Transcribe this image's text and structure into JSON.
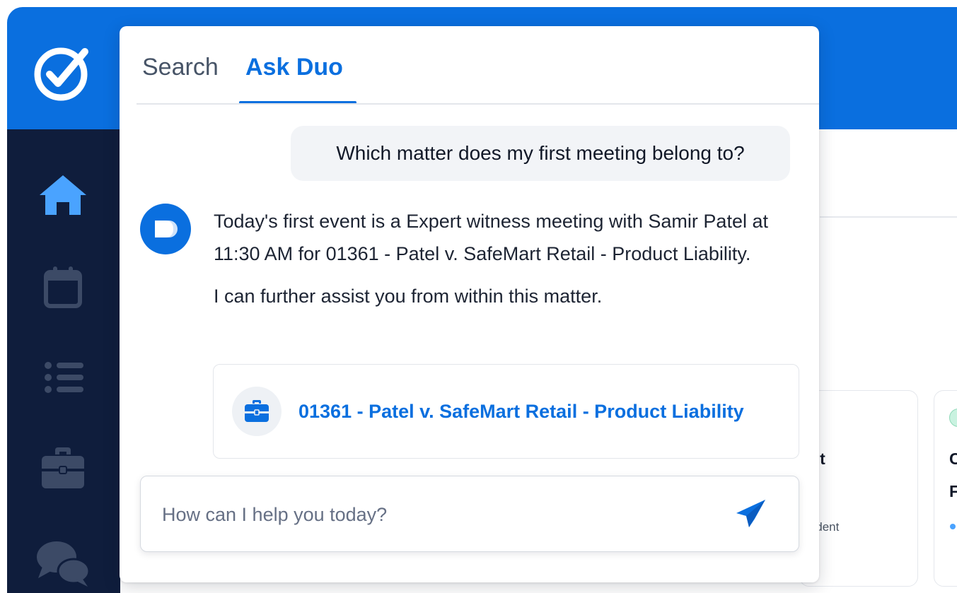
{
  "colors": {
    "brand_blue": "#0a6fdf",
    "sidebar_navy": "#0f1d3c",
    "nav_icon_muted": "#3c4a66",
    "user_bubble_bg": "#f2f4f7"
  },
  "sidebar": {
    "logo_icon": "checkmark-badge-icon",
    "items": [
      {
        "icon": "home-icon",
        "active": true
      },
      {
        "icon": "calendar-icon",
        "active": false
      },
      {
        "icon": "list-icon",
        "active": false
      },
      {
        "icon": "briefcase-icon",
        "active": false
      },
      {
        "icon": "chat-icon",
        "active": false
      }
    ]
  },
  "background": {
    "card_title_fragment": "sit",
    "card_sub_fragment": "cident",
    "right_card_line1": "C",
    "right_card_line2": "F"
  },
  "panel": {
    "tabs": [
      {
        "label": "Search",
        "active": false
      },
      {
        "label": "Ask Duo",
        "active": true
      }
    ],
    "user_message": "Which matter does my first meeting belong to?",
    "assistant": {
      "avatar_icon": "duo-avatar-icon",
      "paragraphs": [
        "Today's first event is a Expert witness meeting with Samir Patel at 11:30 AM for 01361 - Patel v. SafeMart Retail - Product Liability.",
        "I can further assist you from within this matter."
      ]
    },
    "matter_card": {
      "icon": "briefcase-icon",
      "label": "01361 - Patel v. SafeMart Retail - Product Liability"
    },
    "input": {
      "placeholder": "How can I help you today?",
      "value": "",
      "send_icon": "send-icon"
    }
  }
}
